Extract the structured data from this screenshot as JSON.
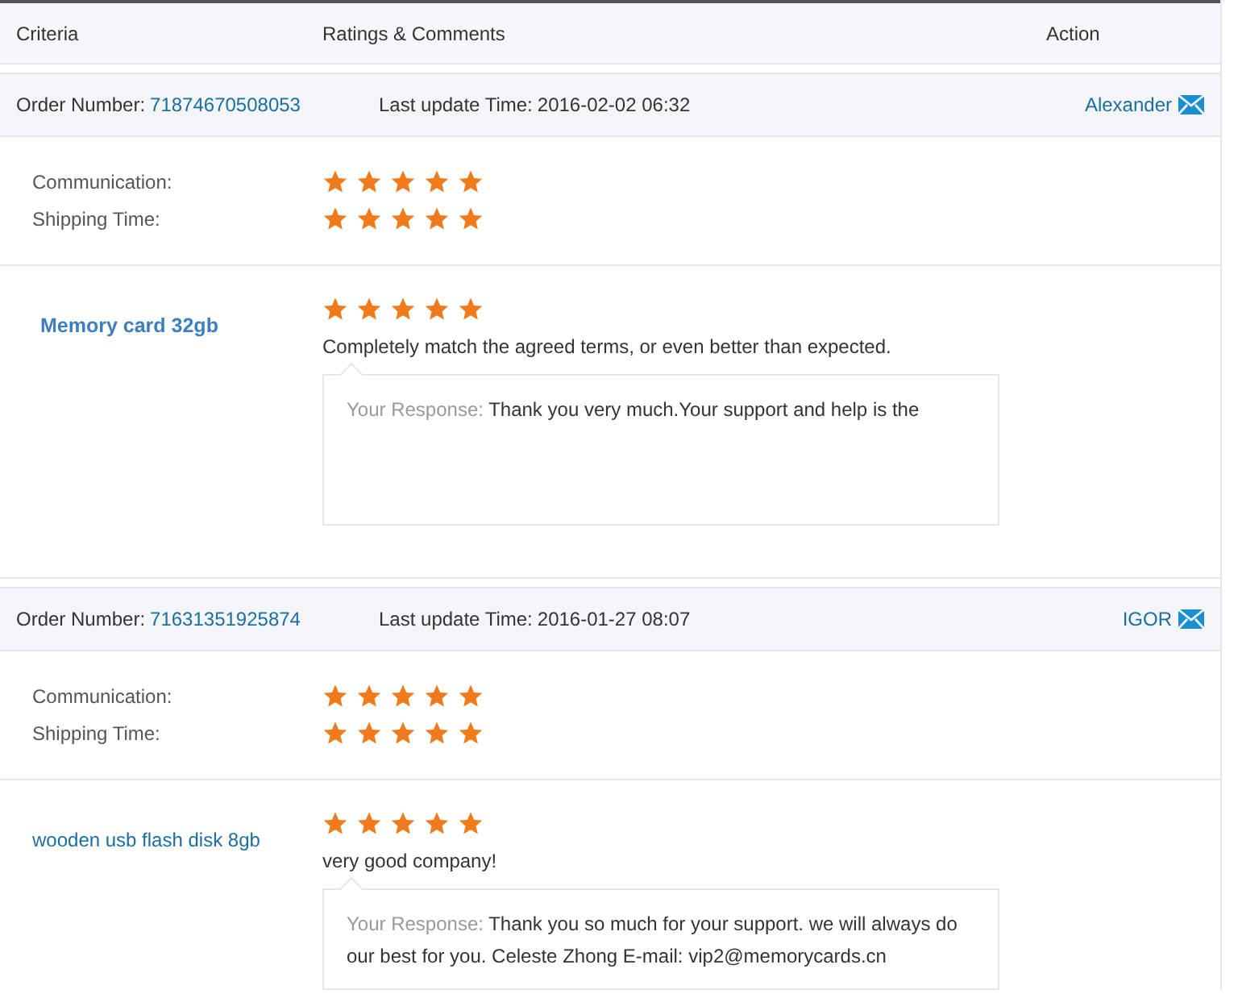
{
  "columns": [
    "Criteria",
    "Ratings & Comments",
    "Action"
  ],
  "orders": [
    {
      "order_label": "Order Number:",
      "order_number": "71874670508053",
      "update_label": "Last update Time:",
      "update_time": "2016-02-02 06:32",
      "buyer": "Alexander",
      "criteria": [
        {
          "label": "Communication:",
          "stars": 5
        },
        {
          "label": "Shipping Time:",
          "stars": 5
        }
      ],
      "product": {
        "name": "Memory card 32gb",
        "bold": true,
        "stars": 5,
        "comment": "Completely match the agreed terms, or even better than expected.",
        "response_label": "Your Response:",
        "response": "Thank you very much.Your support and help is the"
      }
    },
    {
      "order_label": "Order Number:",
      "order_number": "71631351925874",
      "update_label": "Last update Time:",
      "update_time": "2016-01-27 08:07",
      "buyer": "IGOR",
      "criteria": [
        {
          "label": "Communication:",
          "stars": 5
        },
        {
          "label": "Shipping Time:",
          "stars": 5
        }
      ],
      "product": {
        "name": "wooden usb flash disk 8gb",
        "bold": false,
        "stars": 5,
        "comment": "very good company!",
        "response_label": "Your Response:",
        "response": "Thank you so much for your support. we will always do our best for you. Celeste Zhong E-mail: vip2@memorycards.cn"
      }
    }
  ]
}
